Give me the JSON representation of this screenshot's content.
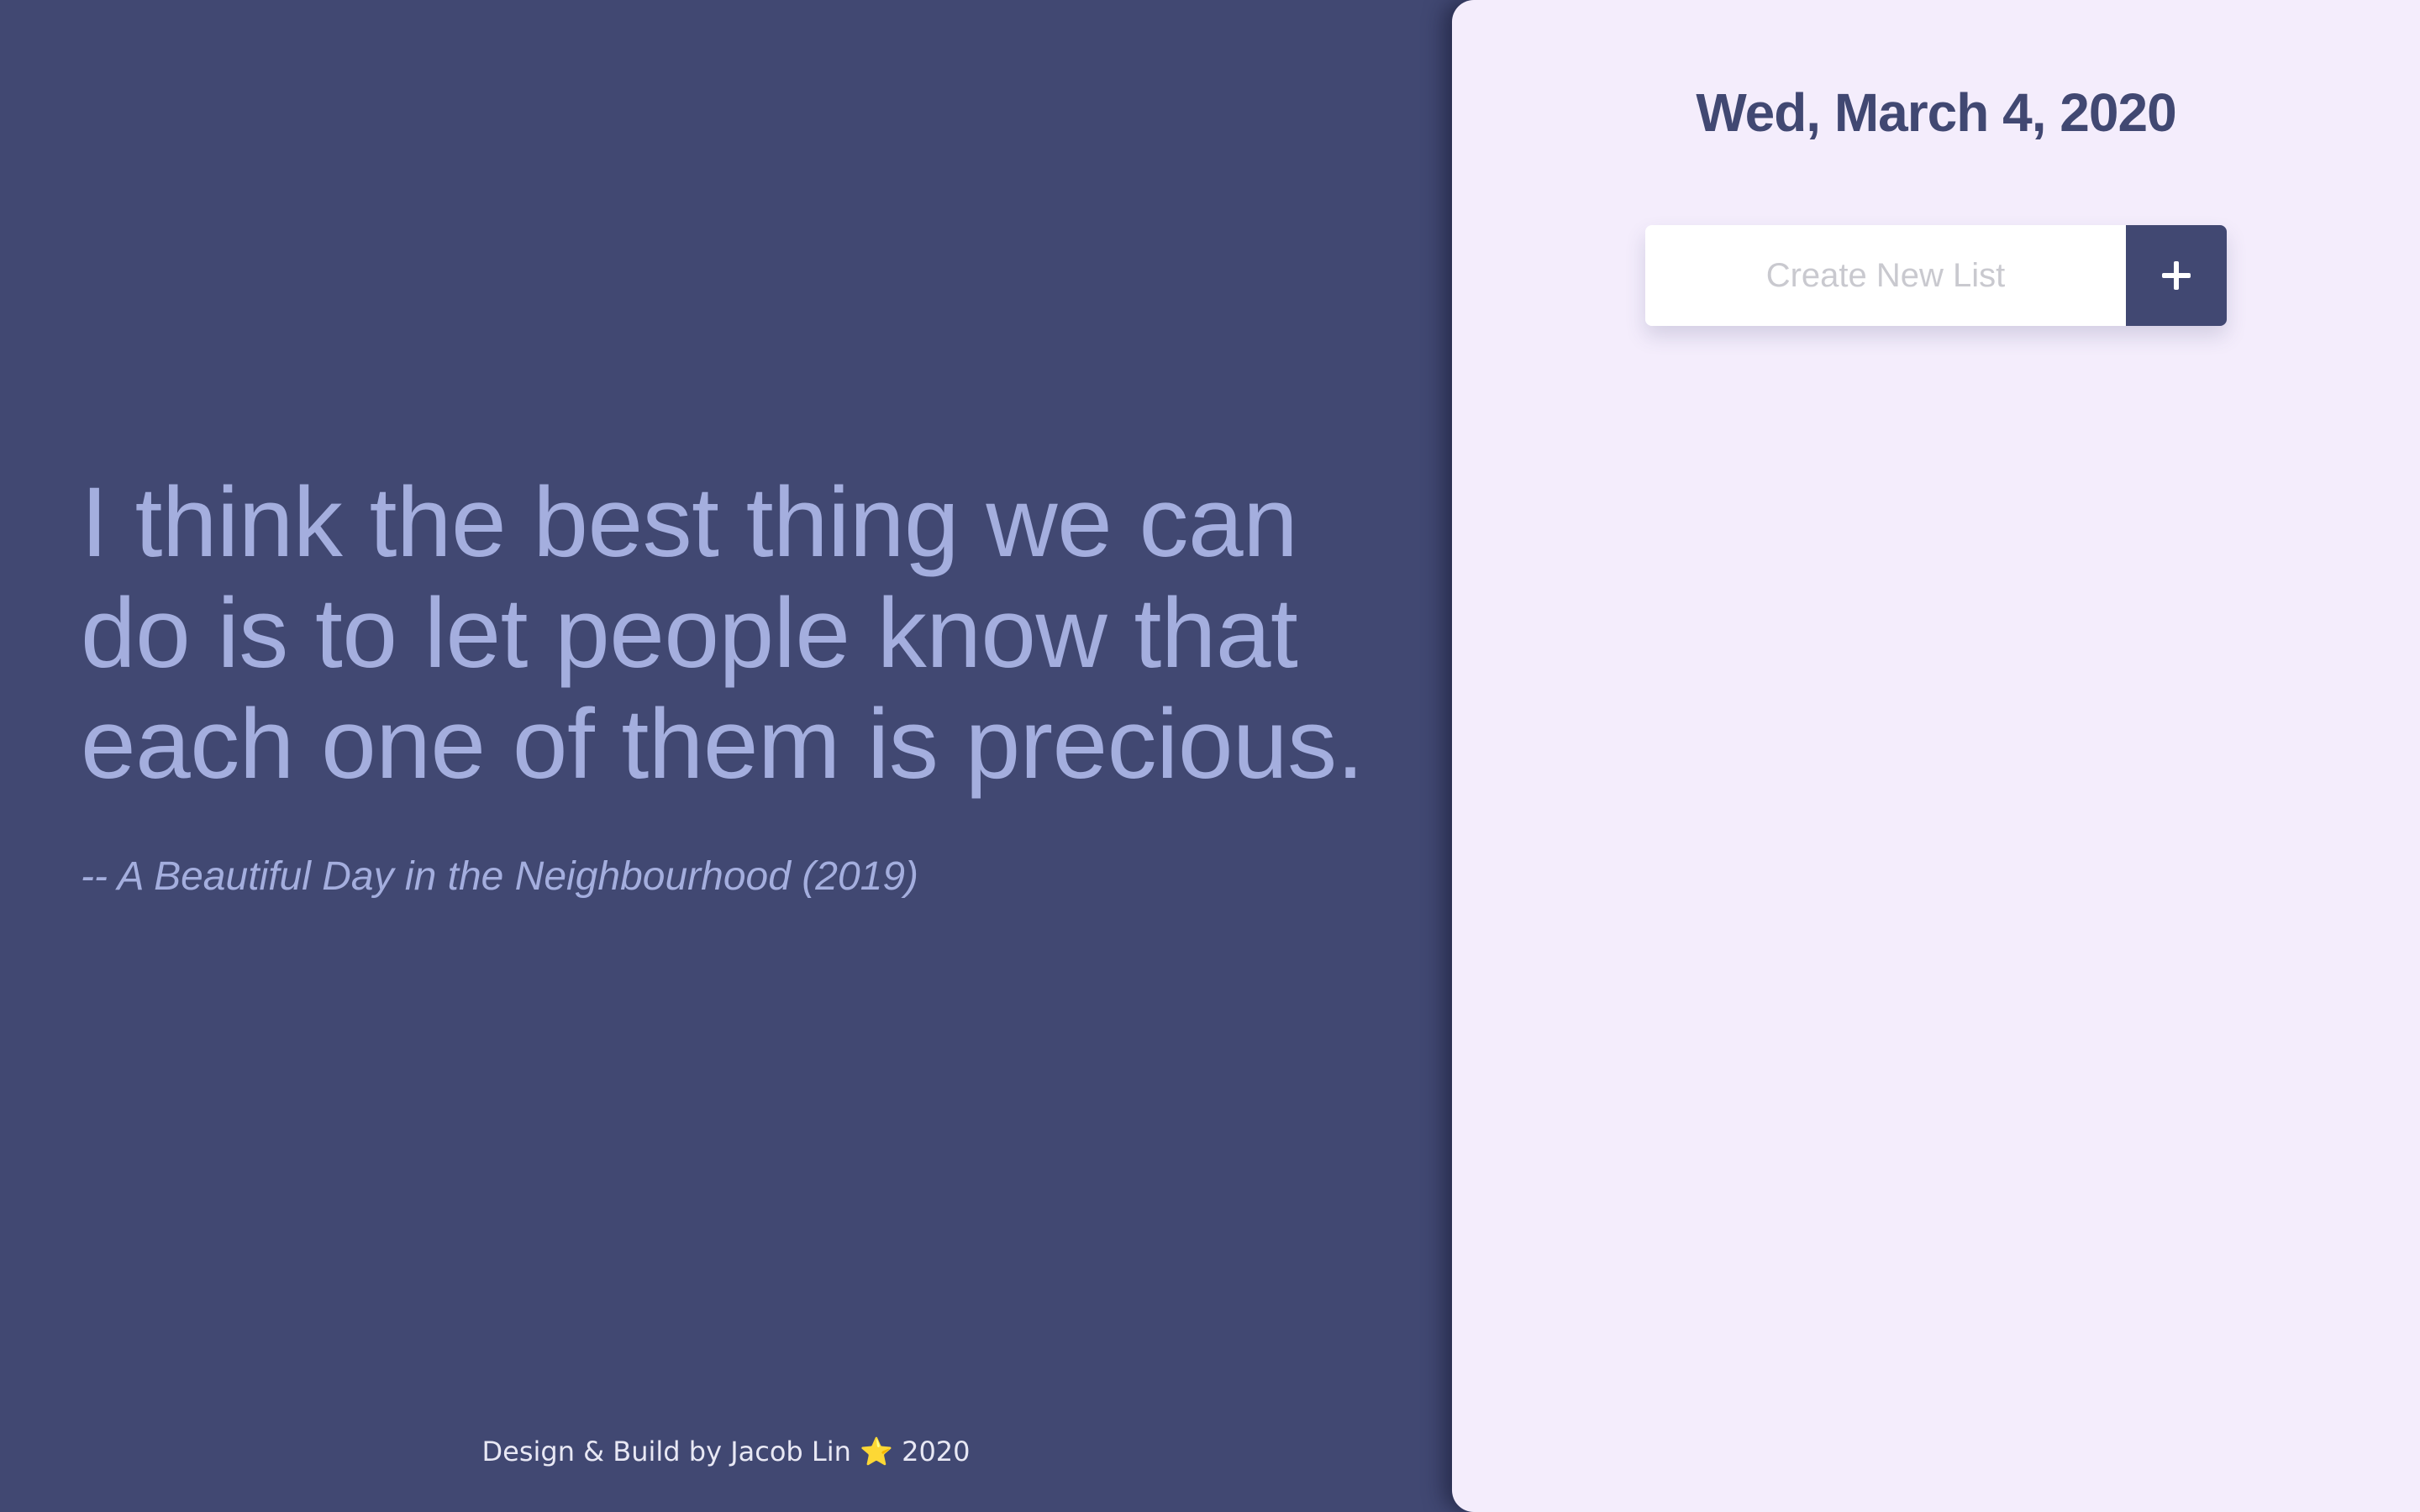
{
  "quote": {
    "text": "I think the best thing we can do is to let people know that each one of them is precious.",
    "attribution": "-- A Beautiful Day in the Neighbourhood (2019)"
  },
  "footer": {
    "prefix": "Design & Build by Jacob Lin",
    "star_icon": "⭐",
    "year": "2020"
  },
  "panel": {
    "date": "Wed, March 4, 2020",
    "new_list": {
      "placeholder": "Create New List",
      "value": "",
      "add_icon": "plus-icon"
    }
  },
  "colors": {
    "background": "#414872",
    "quote_text": "#a4aede",
    "panel_background": "#f4edfc",
    "accent": "#414872"
  }
}
